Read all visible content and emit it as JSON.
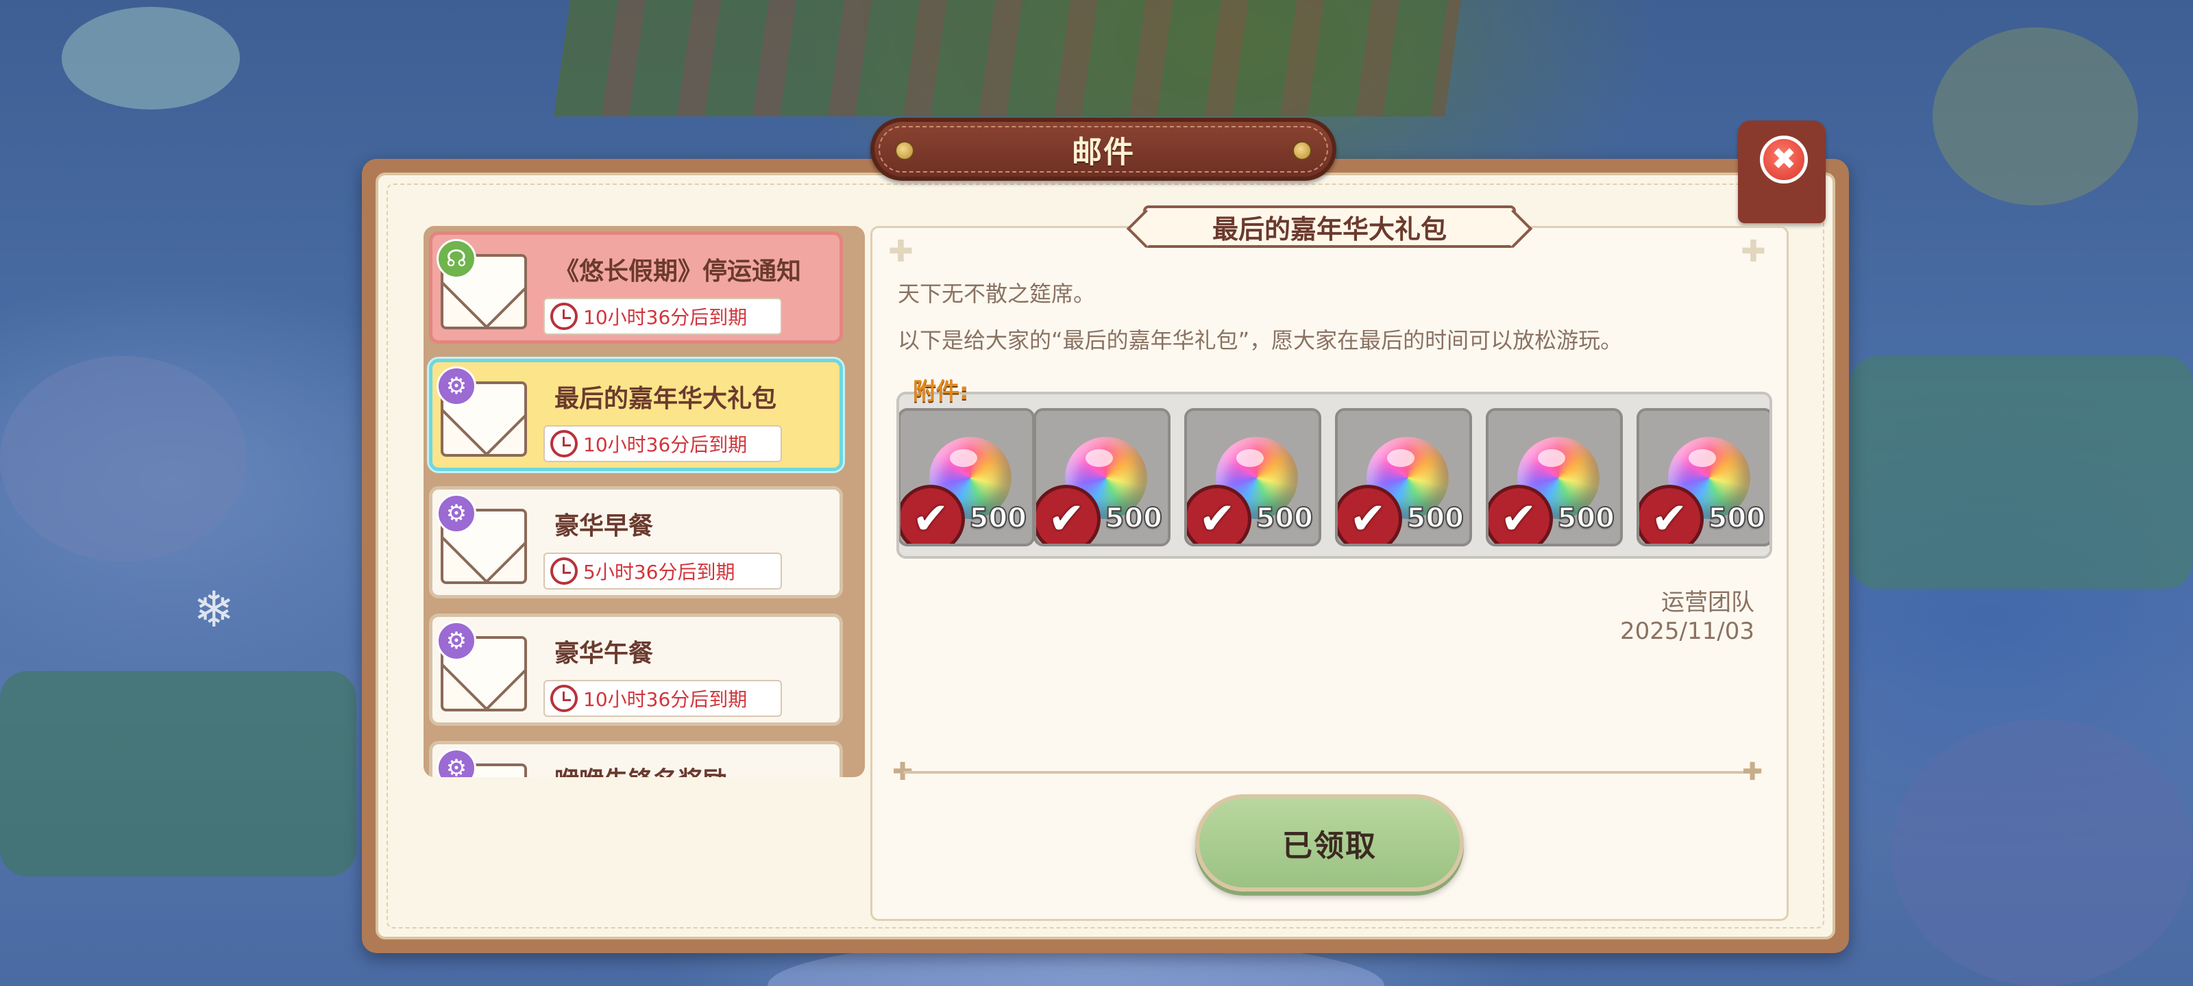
{
  "window": {
    "title": "邮件",
    "close_glyph": "✖"
  },
  "mail_list": [
    {
      "title": "《悠长假期》停运通知",
      "expiry": "10小时36分后到期",
      "badge_icon": "headset-icon",
      "style": "unread-red"
    },
    {
      "title": "最后的嘉年华大礼包",
      "expiry": "10小时36分后到期",
      "badge_icon": "gear-icon",
      "style": "selected"
    },
    {
      "title": "豪华早餐",
      "expiry": "5小时36分后到期",
      "badge_icon": "gear-icon",
      "style": "normal"
    },
    {
      "title": "豪华午餐",
      "expiry": "10小时36分后到期",
      "badge_icon": "gear-icon",
      "style": "normal"
    },
    {
      "title": "咿咿先锋名奖励",
      "expiry": "",
      "badge_icon": "gear-icon",
      "style": "normal"
    }
  ],
  "mail_detail": {
    "title": "最后的嘉年华大礼包",
    "line1": "天下无不散之筵席。",
    "line2": "以下是给大家的“最后的嘉年华礼包”，愿大家在最后的时间可以放松游玩。",
    "attachments_label": "附件:",
    "attachments": [
      {
        "icon": "rainbow-orb-icon",
        "quantity": "500",
        "claimed": true
      },
      {
        "icon": "rainbow-orb-icon",
        "quantity": "500",
        "claimed": true
      },
      {
        "icon": "rainbow-orb-icon",
        "quantity": "500",
        "claimed": true
      },
      {
        "icon": "rainbow-orb-icon",
        "quantity": "500",
        "claimed": true
      },
      {
        "icon": "rainbow-orb-icon",
        "quantity": "500",
        "claimed": true
      },
      {
        "icon": "rainbow-orb-icon",
        "quantity": "500",
        "claimed": true
      }
    ],
    "sender": "运营团队",
    "date": "2025/11/03",
    "claim_button_label": "已领取"
  },
  "icons": {
    "check": "✔",
    "gear": "⚙",
    "headset": "☊",
    "snowflake": "❄",
    "deco": "✚"
  },
  "colors": {
    "title_plate": "#7a3a2a",
    "timer_text": "#d2353b",
    "selected_border": "#6fd7e0",
    "claim_button": "#a8cc8e",
    "attach_label": "#e08a1c"
  }
}
